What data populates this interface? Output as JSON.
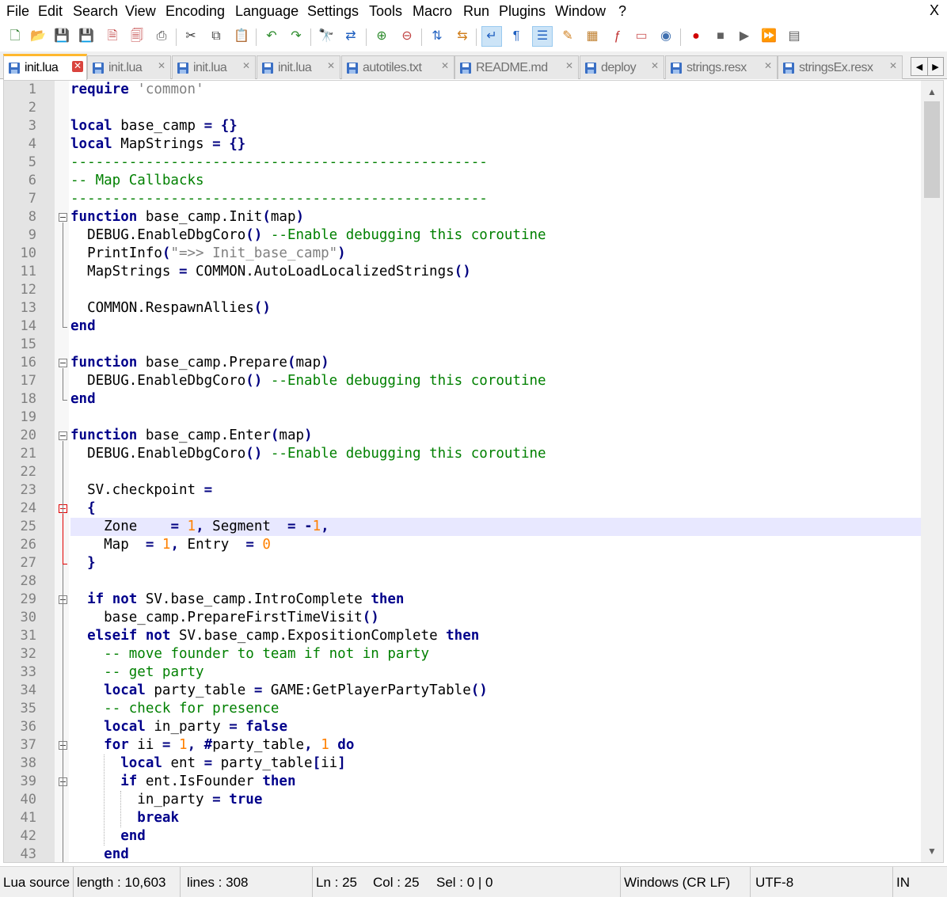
{
  "menubar": {
    "items": [
      "File",
      "Edit",
      "Search",
      "View",
      "Encoding",
      "Language",
      "Settings",
      "Tools",
      "Macro",
      "Run",
      "Plugins",
      "Window",
      "?"
    ],
    "close": "X"
  },
  "toolbar": {
    "icons": [
      "new-file-icon",
      "open-file-icon",
      "save-icon",
      "save-all-icon",
      "close-icon",
      "close-all-icon",
      "print-icon",
      "cut-icon",
      "copy-icon",
      "paste-icon",
      "undo-icon",
      "redo-icon",
      "find-icon",
      "replace-icon",
      "zoom-in-icon",
      "zoom-out-icon",
      "sync-vertical-icon",
      "sync-horizontal-icon",
      "word-wrap-icon",
      "show-all-characters-icon",
      "indent-guide-icon",
      "user-language-icon",
      "document-map-icon",
      "function-list-icon",
      "folder-workspace-icon",
      "monitoring-icon",
      "record-macro-icon",
      "stop-macro-icon",
      "play-macro-icon",
      "run-macro-multiple-icon",
      "save-macro-icon"
    ]
  },
  "tabs": [
    {
      "label": "init.lua",
      "active": true
    },
    {
      "label": "init.lua",
      "active": false
    },
    {
      "label": "init.lua",
      "active": false
    },
    {
      "label": "init.lua",
      "active": false
    },
    {
      "label": "autotiles.txt",
      "active": false
    },
    {
      "label": "README.md",
      "active": false
    },
    {
      "label": "deploy",
      "active": false
    },
    {
      "label": "strings.resx",
      "active": false
    },
    {
      "label": "stringsEx.resx",
      "active": false
    }
  ],
  "tab_close_symbol": "✕",
  "editor": {
    "current_line": 25,
    "lines": [
      {
        "n": 1,
        "tokens": [
          [
            "kw",
            "require"
          ],
          [
            "ident",
            " "
          ],
          [
            "str",
            "'common'"
          ]
        ]
      },
      {
        "n": 2,
        "tokens": []
      },
      {
        "n": 3,
        "tokens": [
          [
            "kw",
            "local"
          ],
          [
            "ident",
            " base_camp "
          ],
          [
            "op",
            "="
          ],
          [
            "ident",
            " "
          ],
          [
            "op",
            "{}"
          ]
        ]
      },
      {
        "n": 4,
        "tokens": [
          [
            "kw",
            "local"
          ],
          [
            "ident",
            " MapStrings "
          ],
          [
            "op",
            "="
          ],
          [
            "ident",
            " "
          ],
          [
            "op",
            "{}"
          ]
        ]
      },
      {
        "n": 5,
        "tokens": [
          [
            "cmt",
            "--------------------------------------------------"
          ]
        ]
      },
      {
        "n": 6,
        "tokens": [
          [
            "cmt",
            "-- Map Callbacks"
          ]
        ]
      },
      {
        "n": 7,
        "tokens": [
          [
            "cmt",
            "--------------------------------------------------"
          ]
        ]
      },
      {
        "n": 8,
        "tokens": [
          [
            "kw",
            "function"
          ],
          [
            "ident",
            " base_camp.Init"
          ],
          [
            "op",
            "("
          ],
          [
            "ident",
            "map"
          ],
          [
            "op",
            ")"
          ]
        ]
      },
      {
        "n": 9,
        "tokens": [
          [
            "ident",
            "  DEBUG.EnableDbgCoro"
          ],
          [
            "op",
            "()"
          ],
          [
            "ident",
            " "
          ],
          [
            "cmt",
            "--Enable debugging this coroutine"
          ]
        ]
      },
      {
        "n": 10,
        "tokens": [
          [
            "ident",
            "  PrintInfo"
          ],
          [
            "op",
            "("
          ],
          [
            "str",
            "\"=>> Init_base_camp\""
          ],
          [
            "op",
            ")"
          ]
        ]
      },
      {
        "n": 11,
        "tokens": [
          [
            "ident",
            "  MapStrings "
          ],
          [
            "op",
            "="
          ],
          [
            "ident",
            " COMMON.AutoLoadLocalizedStrings"
          ],
          [
            "op",
            "()"
          ]
        ]
      },
      {
        "n": 12,
        "tokens": []
      },
      {
        "n": 13,
        "tokens": [
          [
            "ident",
            "  COMMON.RespawnAllies"
          ],
          [
            "op",
            "()"
          ]
        ]
      },
      {
        "n": 14,
        "tokens": [
          [
            "kw",
            "end"
          ]
        ]
      },
      {
        "n": 15,
        "tokens": []
      },
      {
        "n": 16,
        "tokens": [
          [
            "kw",
            "function"
          ],
          [
            "ident",
            " base_camp.Prepare"
          ],
          [
            "op",
            "("
          ],
          [
            "ident",
            "map"
          ],
          [
            "op",
            ")"
          ]
        ]
      },
      {
        "n": 17,
        "tokens": [
          [
            "ident",
            "  DEBUG.EnableDbgCoro"
          ],
          [
            "op",
            "()"
          ],
          [
            "ident",
            " "
          ],
          [
            "cmt",
            "--Enable debugging this coroutine"
          ]
        ]
      },
      {
        "n": 18,
        "tokens": [
          [
            "kw",
            "end"
          ]
        ]
      },
      {
        "n": 19,
        "tokens": []
      },
      {
        "n": 20,
        "tokens": [
          [
            "kw",
            "function"
          ],
          [
            "ident",
            " base_camp.Enter"
          ],
          [
            "op",
            "("
          ],
          [
            "ident",
            "map"
          ],
          [
            "op",
            ")"
          ]
        ]
      },
      {
        "n": 21,
        "tokens": [
          [
            "ident",
            "  DEBUG.EnableDbgCoro"
          ],
          [
            "op",
            "()"
          ],
          [
            "ident",
            " "
          ],
          [
            "cmt",
            "--Enable debugging this coroutine"
          ]
        ]
      },
      {
        "n": 22,
        "tokens": []
      },
      {
        "n": 23,
        "tokens": [
          [
            "ident",
            "  SV.checkpoint "
          ],
          [
            "op",
            "="
          ]
        ]
      },
      {
        "n": 24,
        "tokens": [
          [
            "ident",
            "  "
          ],
          [
            "op",
            "{"
          ]
        ]
      },
      {
        "n": 25,
        "tokens": [
          [
            "ident",
            "    Zone    "
          ],
          [
            "op",
            "="
          ],
          [
            "ident",
            " "
          ],
          [
            "num",
            "1"
          ],
          [
            "op",
            ","
          ],
          [
            "ident",
            " Segment  "
          ],
          [
            "op",
            "="
          ],
          [
            "ident",
            " "
          ],
          [
            "op",
            "-"
          ],
          [
            "num",
            "1"
          ],
          [
            "op",
            ","
          ]
        ]
      },
      {
        "n": 26,
        "tokens": [
          [
            "ident",
            "    Map  "
          ],
          [
            "op",
            "="
          ],
          [
            "ident",
            " "
          ],
          [
            "num",
            "1"
          ],
          [
            "op",
            ","
          ],
          [
            "ident",
            " Entry  "
          ],
          [
            "op",
            "="
          ],
          [
            "ident",
            " "
          ],
          [
            "num",
            "0"
          ]
        ]
      },
      {
        "n": 27,
        "tokens": [
          [
            "ident",
            "  "
          ],
          [
            "op",
            "}"
          ]
        ]
      },
      {
        "n": 28,
        "tokens": []
      },
      {
        "n": 29,
        "tokens": [
          [
            "ident",
            "  "
          ],
          [
            "kw",
            "if"
          ],
          [
            "ident",
            " "
          ],
          [
            "kw",
            "not"
          ],
          [
            "ident",
            " SV.base_camp.IntroComplete "
          ],
          [
            "kw",
            "then"
          ]
        ]
      },
      {
        "n": 30,
        "tokens": [
          [
            "ident",
            "    base_camp.PrepareFirstTimeVisit"
          ],
          [
            "op",
            "()"
          ]
        ]
      },
      {
        "n": 31,
        "tokens": [
          [
            "ident",
            "  "
          ],
          [
            "kw",
            "elseif"
          ],
          [
            "ident",
            " "
          ],
          [
            "kw",
            "not"
          ],
          [
            "ident",
            " SV.base_camp.ExpositionComplete "
          ],
          [
            "kw",
            "then"
          ]
        ]
      },
      {
        "n": 32,
        "tokens": [
          [
            "ident",
            "    "
          ],
          [
            "cmt",
            "-- move founder to team if not in party"
          ]
        ]
      },
      {
        "n": 33,
        "tokens": [
          [
            "ident",
            "    "
          ],
          [
            "cmt",
            "-- get party"
          ]
        ]
      },
      {
        "n": 34,
        "tokens": [
          [
            "ident",
            "    "
          ],
          [
            "kw",
            "local"
          ],
          [
            "ident",
            " party_table "
          ],
          [
            "op",
            "="
          ],
          [
            "ident",
            " GAME:GetPlayerPartyTable"
          ],
          [
            "op",
            "()"
          ]
        ]
      },
      {
        "n": 35,
        "tokens": [
          [
            "ident",
            "    "
          ],
          [
            "cmt",
            "-- check for presence"
          ]
        ]
      },
      {
        "n": 36,
        "tokens": [
          [
            "ident",
            "    "
          ],
          [
            "kw",
            "local"
          ],
          [
            "ident",
            " in_party "
          ],
          [
            "op",
            "="
          ],
          [
            "ident",
            " "
          ],
          [
            "kw",
            "false"
          ]
        ]
      },
      {
        "n": 37,
        "tokens": [
          [
            "ident",
            "    "
          ],
          [
            "kw",
            "for"
          ],
          [
            "ident",
            " ii "
          ],
          [
            "op",
            "="
          ],
          [
            "ident",
            " "
          ],
          [
            "num",
            "1"
          ],
          [
            "op",
            ","
          ],
          [
            "ident",
            " "
          ],
          [
            "op",
            "#"
          ],
          [
            "ident",
            "party_table"
          ],
          [
            "op",
            ","
          ],
          [
            "ident",
            " "
          ],
          [
            "num",
            "1"
          ],
          [
            "ident",
            " "
          ],
          [
            "kw",
            "do"
          ]
        ]
      },
      {
        "n": 38,
        "tokens": [
          [
            "ident",
            "      "
          ],
          [
            "kw",
            "local"
          ],
          [
            "ident",
            " ent "
          ],
          [
            "op",
            "="
          ],
          [
            "ident",
            " party_table"
          ],
          [
            "op",
            "["
          ],
          [
            "ident",
            "ii"
          ],
          [
            "op",
            "]"
          ]
        ]
      },
      {
        "n": 39,
        "tokens": [
          [
            "ident",
            "      "
          ],
          [
            "kw",
            "if"
          ],
          [
            "ident",
            " ent.IsFounder "
          ],
          [
            "kw",
            "then"
          ]
        ]
      },
      {
        "n": 40,
        "tokens": [
          [
            "ident",
            "        in_party "
          ],
          [
            "op",
            "="
          ],
          [
            "ident",
            " "
          ],
          [
            "kw",
            "true"
          ]
        ]
      },
      {
        "n": 41,
        "tokens": [
          [
            "ident",
            "        "
          ],
          [
            "kw",
            "break"
          ]
        ]
      },
      {
        "n": 42,
        "tokens": [
          [
            "ident",
            "      "
          ],
          [
            "kw",
            "end"
          ]
        ]
      },
      {
        "n": 43,
        "tokens": [
          [
            "ident",
            "    "
          ],
          [
            "kw",
            "end"
          ]
        ]
      }
    ]
  },
  "scrollbar": {
    "up": "▲",
    "down": "▼",
    "position_fraction": 0.0
  },
  "statusbar": {
    "language": "Lua source",
    "length": "length : 10,603",
    "lines": "lines : 308",
    "ln": "Ln : 25",
    "col": "Col : 25",
    "sel": "Sel : 0 | 0",
    "eol": "Windows (CR LF)",
    "encoding": "UTF-8",
    "mode": "IN"
  },
  "colors": {
    "keyword": "#00008b",
    "string": "#808080",
    "number": "#ff8000",
    "comment": "#008000",
    "current_line": "#e8e8ff",
    "active_tab_accent": "#ffb82e",
    "gutter": "#e4e4e4"
  }
}
